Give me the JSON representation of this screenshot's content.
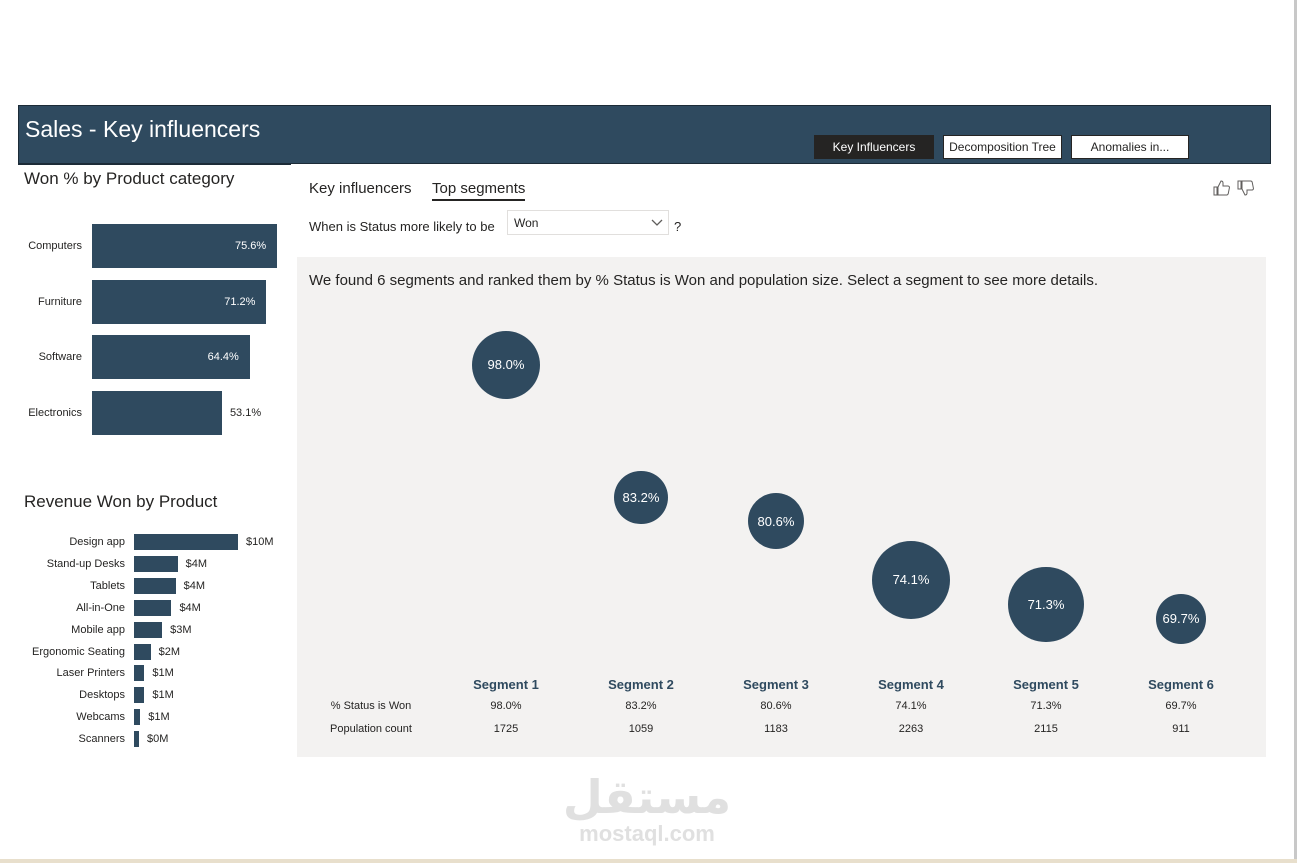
{
  "header": {
    "title": "Sales - Key influencers",
    "nav": [
      {
        "label": "Key Influencers",
        "active": true
      },
      {
        "label": "Decomposition Tree",
        "active": false
      },
      {
        "label": "Anomalies in...",
        "active": false
      }
    ]
  },
  "won_by_category": {
    "title": "Won % by Product category",
    "chart_data": {
      "type": "bar",
      "orientation": "horizontal",
      "title": "Won % by Product category",
      "categories": [
        "Computers",
        "Furniture",
        "Software",
        "Electronics"
      ],
      "values": [
        75.6,
        71.2,
        64.4,
        53.1
      ],
      "value_labels": [
        "75.6%",
        "71.2%",
        "64.4%",
        "53.1%"
      ],
      "unit": "%",
      "xlim": [
        0,
        75.6
      ],
      "bar_color": "#2f4a5f"
    }
  },
  "revenue_by_product": {
    "title": "Revenue Won by Product",
    "chart_data": {
      "type": "bar",
      "orientation": "horizontal",
      "title": "Revenue Won by Product",
      "categories": [
        "Design app",
        "Stand-up Desks",
        "Tablets",
        "All-in-One",
        "Mobile app",
        "Ergonomic Seating",
        "Laser Printers",
        "Desktops",
        "Webcams",
        "Scanners"
      ],
      "values": [
        10,
        4.2,
        4.0,
        3.6,
        2.7,
        1.6,
        1.0,
        1.0,
        0.6,
        0.4
      ],
      "value_labels": [
        "$10M",
        "$4M",
        "$4M",
        "$4M",
        "$3M",
        "$2M",
        "$1M",
        "$1M",
        "$1M",
        "$0M"
      ],
      "unit": "$M",
      "xlim": [
        0,
        10
      ],
      "bar_color": "#2f4a5f"
    }
  },
  "key_influencers": {
    "tabs": [
      {
        "label": "Key influencers",
        "selected": false
      },
      {
        "label": "Top segments",
        "selected": true
      }
    ],
    "question_prefix": "When is Status more likely to be",
    "dropdown_value": "Won",
    "question_suffix": "?",
    "description": "We found 6 segments and ranked them by % Status is Won and population size. Select a segment to see more details.",
    "icons": [
      "thumbs-up-icon",
      "thumbs-down-icon",
      "chevron-down-icon"
    ],
    "row_labels": {
      "won": "% Status is Won",
      "population": "Population count"
    },
    "chart_data": {
      "type": "scatter",
      "y_metric": "% Status is Won",
      "size_metric": "Population count",
      "segments": [
        {
          "name": "Segment 1",
          "won_pct": 98.0,
          "label": "98.0%",
          "population": 1725
        },
        {
          "name": "Segment 2",
          "won_pct": 83.2,
          "label": "83.2%",
          "population": 1059
        },
        {
          "name": "Segment 3",
          "won_pct": 80.6,
          "label": "80.6%",
          "population": 1183
        },
        {
          "name": "Segment 4",
          "won_pct": 74.1,
          "label": "74.1%",
          "population": 2263
        },
        {
          "name": "Segment 5",
          "won_pct": 71.3,
          "label": "71.3%",
          "population": 2115
        },
        {
          "name": "Segment 6",
          "won_pct": 69.7,
          "label": "69.7%",
          "population": 911
        }
      ],
      "bubble_color": "#2f4a5f"
    }
  },
  "watermark": {
    "arabic": "مستقل",
    "latin": "mostaql.com"
  },
  "colors": {
    "accent": "#2f4a5f",
    "panel": "#f3f2f1",
    "text": "#252423"
  }
}
